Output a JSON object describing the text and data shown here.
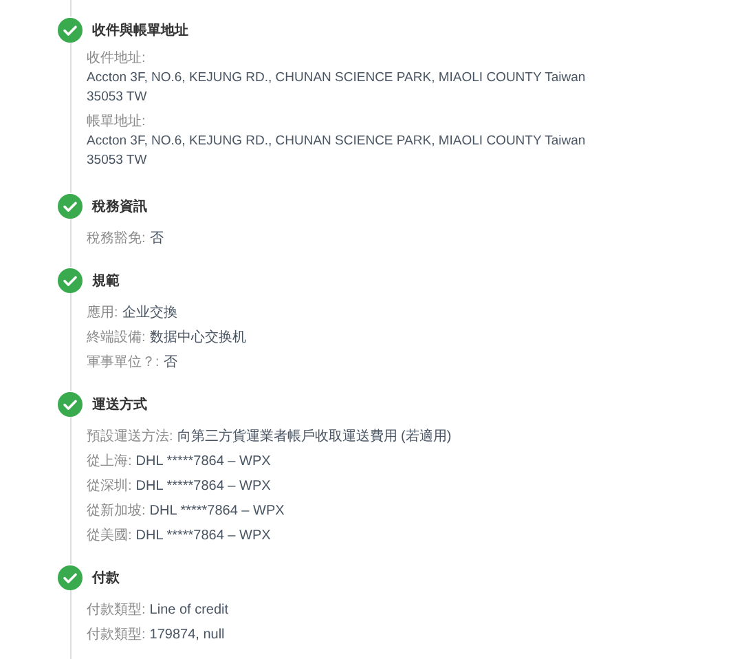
{
  "steps": [
    {
      "title": "收件與帳單地址",
      "completed": true,
      "items": [
        {
          "kind": "block",
          "label": "收件地址:",
          "value": "Accton 3F, NO.6, KEJUNG RD., CHUNAN SCIENCE PARK, MIAOLI COUNTY Taiwan 35053 TW"
        },
        {
          "kind": "block",
          "label": "帳單地址:",
          "value": "Accton 3F, NO.6, KEJUNG RD., CHUNAN SCIENCE PARK, MIAOLI COUNTY Taiwan 35053 TW"
        }
      ]
    },
    {
      "title": "稅務資訊",
      "completed": true,
      "items": [
        {
          "kind": "inline",
          "label": "稅務豁免:",
          "value": "否"
        }
      ]
    },
    {
      "title": "規範",
      "completed": true,
      "items": [
        {
          "kind": "inline",
          "label": "應用:",
          "value": "企业交換"
        },
        {
          "kind": "inline",
          "label": "終端設備:",
          "value": "数据中心交换机"
        },
        {
          "kind": "inline",
          "label": "軍事單位？:",
          "value": "否"
        }
      ]
    },
    {
      "title": "運送方式",
      "completed": true,
      "items": [
        {
          "kind": "inline",
          "label": "預設運送方法:",
          "value": "向第三方貨運業者帳戶收取運送費用 (若適用)"
        },
        {
          "kind": "inline",
          "label": "從上海:",
          "value": "DHL *****7864 – WPX"
        },
        {
          "kind": "inline",
          "label": "從深圳:",
          "value": "DHL *****7864 – WPX"
        },
        {
          "kind": "inline",
          "label": "從新加坡:",
          "value": "DHL *****7864 – WPX"
        },
        {
          "kind": "inline",
          "label": "從美國:",
          "value": "DHL *****7864 – WPX"
        }
      ]
    },
    {
      "title": "付款",
      "completed": true,
      "items": [
        {
          "kind": "inline",
          "label": "付款類型:",
          "value": "Line of credit"
        },
        {
          "kind": "inline",
          "label": "付款類型:",
          "value": "179874, null"
        }
      ]
    }
  ]
}
